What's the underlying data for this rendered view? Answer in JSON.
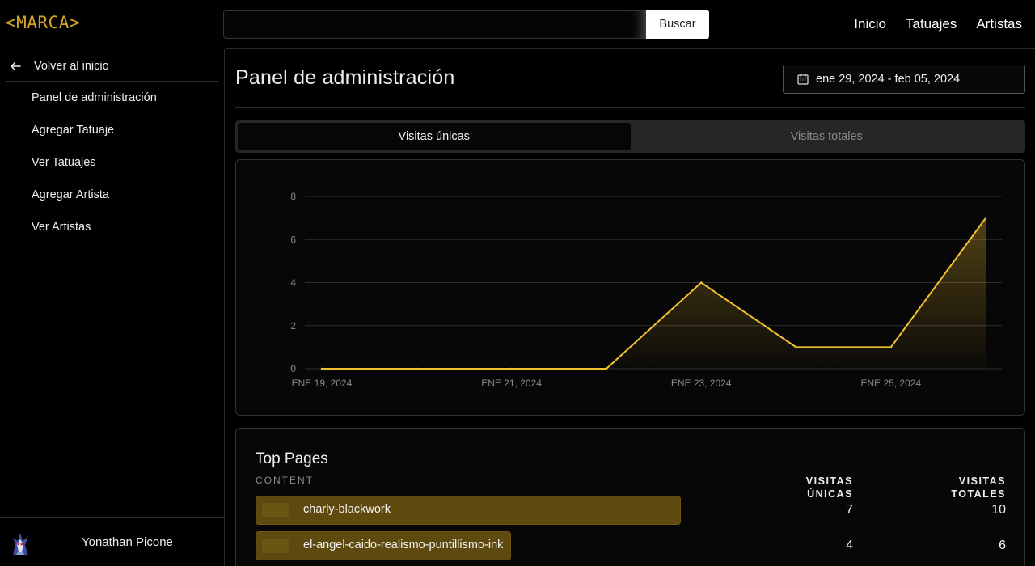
{
  "brand": "<MARCA>",
  "search": {
    "placeholder": "",
    "button_label": "Buscar"
  },
  "topnav": [
    "Inicio",
    "Tatuajes",
    "Artistas"
  ],
  "sidebar": {
    "back_label": "Volver al inicio",
    "items": [
      "Panel de administración",
      "Agregar Tatuaje",
      "Ver Tatuajes",
      "Agregar Artista",
      "Ver Artistas"
    ],
    "user_name": "Yonathan Picone"
  },
  "main": {
    "title": "Panel de administración",
    "date_range": "ene 29, 2024 - feb 05, 2024",
    "tabs": [
      {
        "label": "Visitas únicas",
        "active": true
      },
      {
        "label": "Visitas totales",
        "active": false
      }
    ]
  },
  "chart_data": {
    "type": "area",
    "title": "",
    "xlabel": "",
    "ylabel": "",
    "x_tick_labels": [
      "ENE 19, 2024",
      "ENE 21, 2024",
      "ENE 23, 2024",
      "ENE 25, 2024"
    ],
    "x": [
      "2024-01-19",
      "2024-01-20",
      "2024-01-21",
      "2024-01-22",
      "2024-01-23",
      "2024-01-24",
      "2024-01-25",
      "2024-01-26"
    ],
    "y_ticks": [
      0,
      2,
      4,
      6,
      8
    ],
    "ylim": [
      0,
      8
    ],
    "series": [
      {
        "values": [
          0,
          0,
          0,
          0,
          4,
          1,
          1,
          7
        ]
      }
    ],
    "grid": true,
    "color": "#f0c030"
  },
  "top_pages": {
    "title": "Top Pages",
    "col_content": "CONTENT",
    "col_unique": "VISITAS ÚNICAS",
    "col_total": "VISITAS TOTALES",
    "rows": [
      {
        "name": "charly-blackwork",
        "unique": 7,
        "total": 10
      },
      {
        "name": "el-angel-caido-realismo-puntillismo-ink",
        "unique": 4,
        "total": 6
      }
    ]
  },
  "colors": {
    "accent": "#d4a521",
    "bar": "#5e4a0e",
    "line": "#f0c030"
  }
}
